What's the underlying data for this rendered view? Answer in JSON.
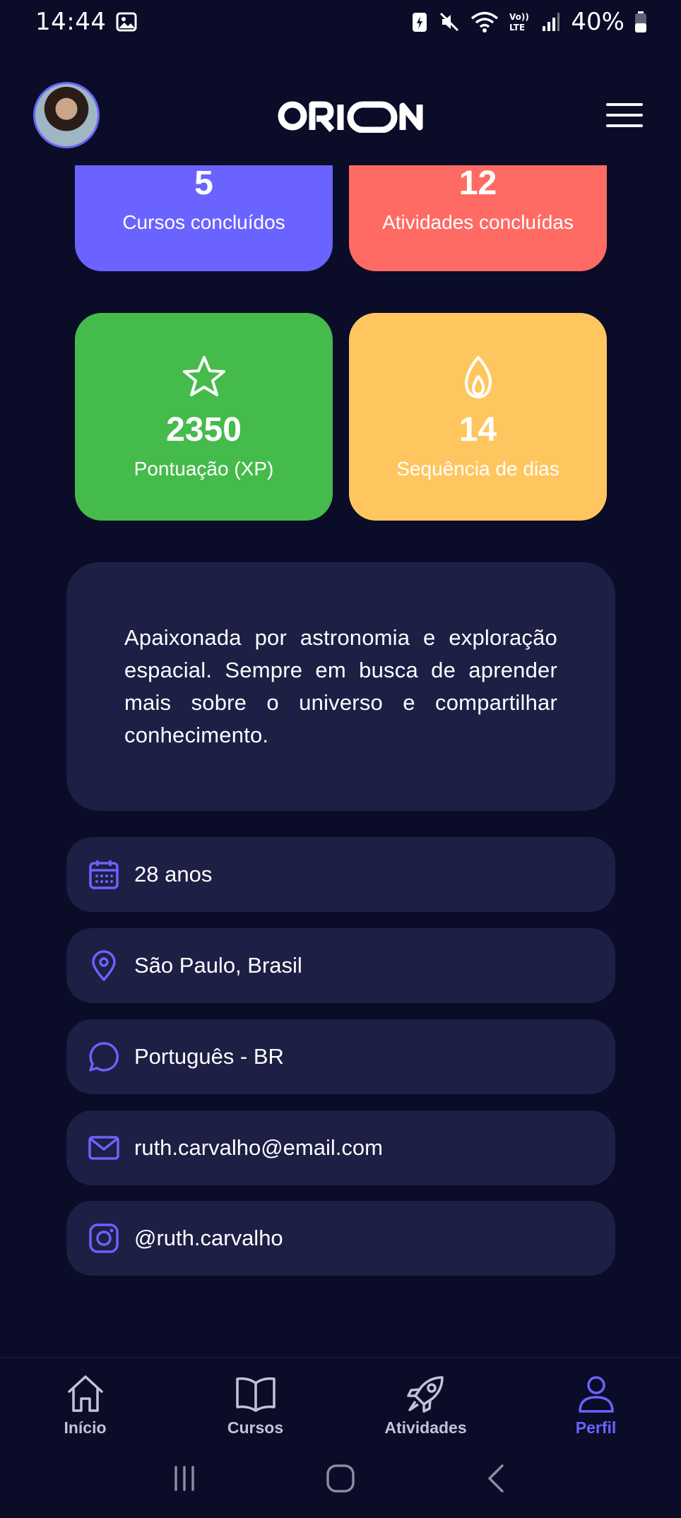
{
  "status_bar": {
    "time": "14:44",
    "battery": "40%"
  },
  "header": {
    "logo_text": "ORION"
  },
  "stats": {
    "courses": {
      "value": "5",
      "label": "Cursos concluídos",
      "color": "#6b63ff"
    },
    "activities": {
      "value": "12",
      "label": "Atividades concluídas",
      "color": "#ff6b64"
    },
    "points": {
      "value": "2350",
      "label": "Pontuação (XP)",
      "color": "#45bb4b",
      "icon": "star-icon"
    },
    "streak": {
      "value": "14",
      "label": "Sequência de dias",
      "color": "#ffc660",
      "icon": "flame-icon"
    }
  },
  "bio": {
    "text": "Apaixonada por astronomia e exploração espacial. Sempre em busca de aprender mais sobre o universo e compartilhar conhecimento."
  },
  "info": [
    {
      "icon": "calendar-icon",
      "text": "28 anos"
    },
    {
      "icon": "location-pin-icon",
      "text": "São Paulo, Brasil"
    },
    {
      "icon": "chat-bubble-icon",
      "text": "Português - BR"
    },
    {
      "icon": "mail-icon",
      "text": "ruth.carvalho@email.com"
    },
    {
      "icon": "instagram-icon",
      "text": "@ruth.carvalho"
    }
  ],
  "nav": {
    "items": [
      {
        "label": "Início",
        "icon": "home-icon"
      },
      {
        "label": "Cursos",
        "icon": "book-icon"
      },
      {
        "label": "Atividades",
        "icon": "rocket-icon"
      },
      {
        "label": "Perfil",
        "icon": "user-icon",
        "active": true
      }
    ]
  },
  "colors": {
    "background": "#0a0c28",
    "surface": "#1d1f45",
    "accent": "#6b63ff"
  }
}
